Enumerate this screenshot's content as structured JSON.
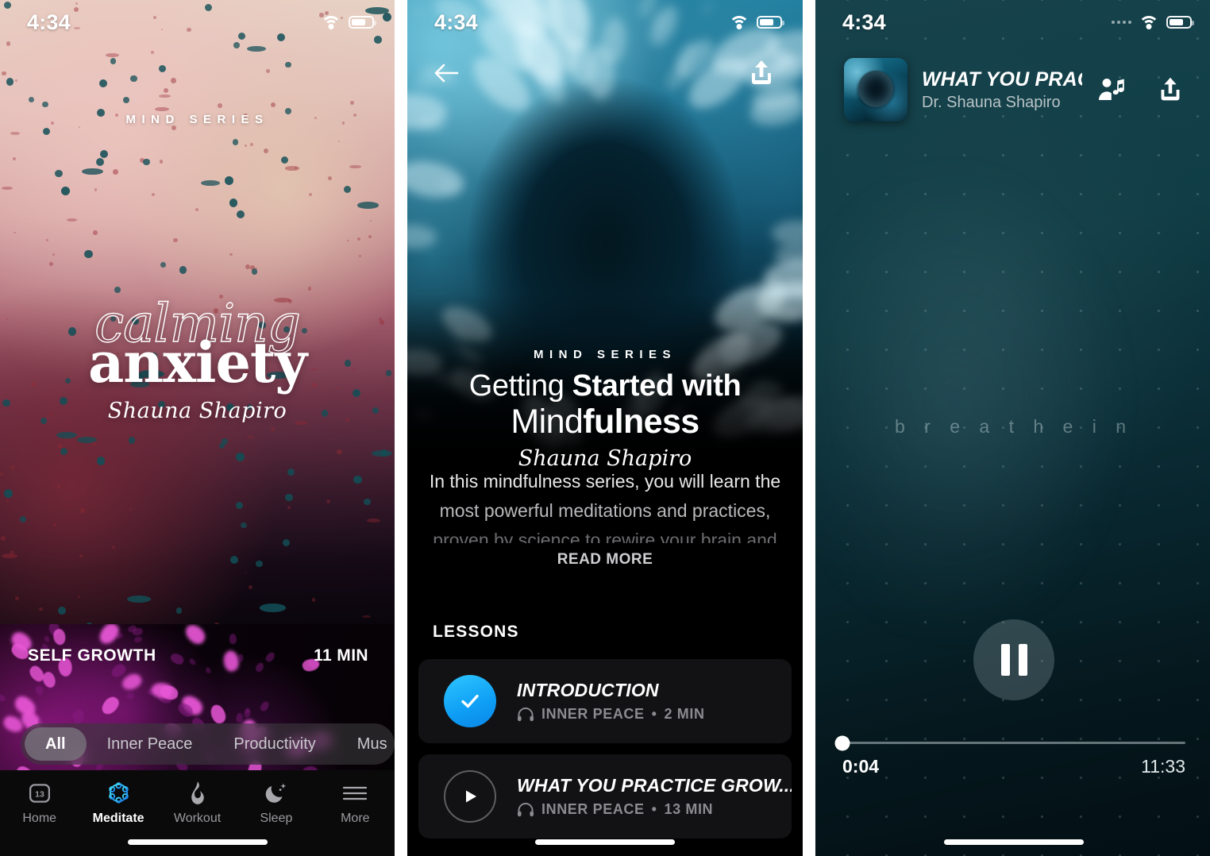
{
  "panel1": {
    "status": {
      "time": "4:34",
      "wifi_icon": "wifi-icon",
      "battery_icon": "battery-icon"
    },
    "hero": {
      "series_label": "MIND SERIES",
      "title_line1": "calming",
      "title_line2": "anxiety",
      "author": "Shauna Shapiro"
    },
    "card": {
      "category": "SELF GROWTH",
      "duration": "11 MIN"
    },
    "filters": [
      {
        "label": "All",
        "active": true
      },
      {
        "label": "Inner Peace",
        "active": false
      },
      {
        "label": "Productivity",
        "active": false
      },
      {
        "label": "Mus",
        "active": false
      }
    ],
    "tabbar": [
      {
        "label": "Home",
        "icon": "calendar-icon",
        "badge": "13",
        "active": false
      },
      {
        "label": "Meditate",
        "icon": "lotus-icon",
        "active": true
      },
      {
        "label": "Workout",
        "icon": "flame-icon",
        "active": false
      },
      {
        "label": "Sleep",
        "icon": "moon-icon",
        "active": false
      },
      {
        "label": "More",
        "icon": "hamburger-icon",
        "active": false
      }
    ]
  },
  "panel2": {
    "status": {
      "time": "4:34",
      "wifi_icon": "wifi-icon",
      "battery_icon": "battery-icon"
    },
    "nav": {
      "back_icon": "back-arrow-icon",
      "share_icon": "share-upload-icon"
    },
    "hero": {
      "series_label": "MIND SERIES",
      "title_line1_light": "Getting ",
      "title_line1_bold": "Started with",
      "title_line2_light": "Mind",
      "title_line2_bold": "fulness",
      "author": "Shauna Shapiro"
    },
    "description": [
      "In this mindfulness series, you will learn the",
      "most powerful meditations and practices,",
      "proven by science to rewire your brain and"
    ],
    "read_more": "READ MORE",
    "lessons_header": "LESSONS",
    "lessons": [
      {
        "state": "completed",
        "icon": "check-icon",
        "title": "INTRODUCTION",
        "meta_icon": "headphones-icon",
        "category": "INNER PEACE",
        "separator": "•",
        "duration": "2 MIN"
      },
      {
        "state": "not_started",
        "icon": "play-icon",
        "title": "WHAT YOU PRACTICE GROW...",
        "meta_icon": "headphones-icon",
        "category": "INNER PEACE",
        "separator": "•",
        "duration": "13 MIN"
      }
    ]
  },
  "panel3": {
    "status": {
      "time": "4:34",
      "signal_icon": "signal-dots-icon",
      "wifi_icon": "wifi-icon",
      "battery_icon": "battery-icon"
    },
    "header": {
      "artwork_icon": "album-art-thumbnail",
      "title": "WHAT YOU PRACTI...",
      "subtitle": "Dr. Shauna Shapiro",
      "cast_icon": "add-to-playlist-icon",
      "share_icon": "share-upload-icon"
    },
    "breathe_cue": "b r e a t h e   i n",
    "controls": {
      "stop_icon": "stop-icon",
      "playpause_icon": "pause-icon"
    },
    "seek": {
      "elapsed": "0:04",
      "remaining": "11:33",
      "progress_percent": 0.6
    }
  },
  "colors": {
    "accent_blue": "#14a6f5",
    "meditate_cyan": "#2bc7f0",
    "dark_bg": "#000000",
    "teal_bg": "#103d46"
  }
}
